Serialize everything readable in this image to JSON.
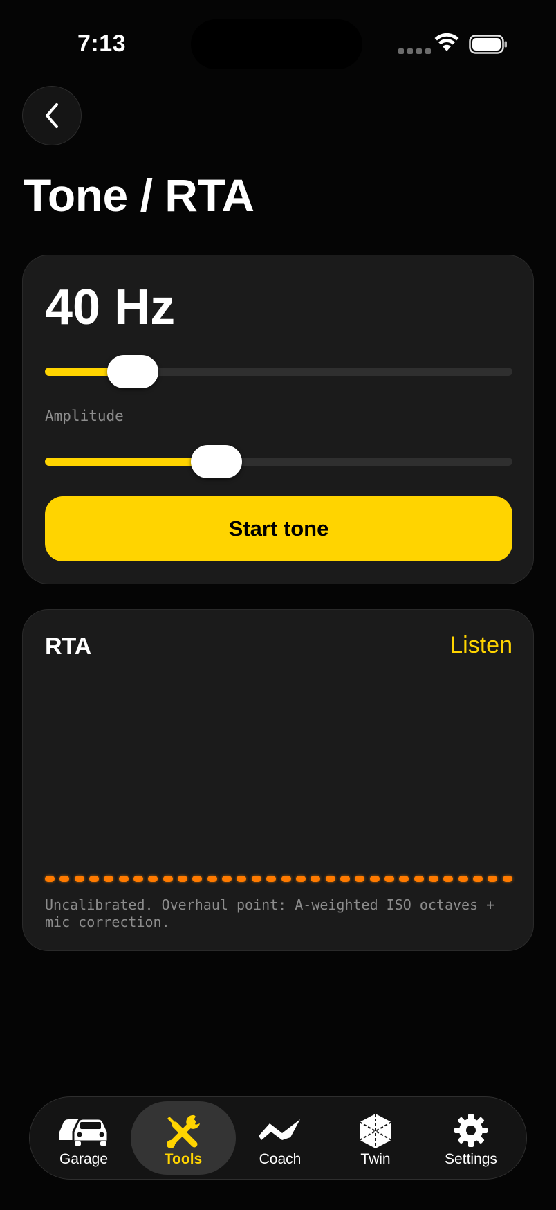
{
  "status_bar": {
    "time": "7:13"
  },
  "page": {
    "title": "Tone / RTA"
  },
  "tone": {
    "frequency_label": "40 Hz",
    "frequency_slider_fraction": 0.15,
    "amplitude_label": "Amplitude",
    "amplitude_slider_fraction": 0.35,
    "start_label": "Start tone"
  },
  "rta": {
    "title": "RTA",
    "listen_label": "Listen",
    "band_count": 32,
    "note": "Uncalibrated. Overhaul point: A-weighted ISO octaves + mic correction."
  },
  "tabs": [
    {
      "label": "Garage",
      "icon": "cars-icon",
      "active": false
    },
    {
      "label": "Tools",
      "icon": "wrench-screwdriver-icon",
      "active": true
    },
    {
      "label": "Coach",
      "icon": "waveform-icon",
      "active": false
    },
    {
      "label": "Twin",
      "icon": "cube-icon",
      "active": false
    },
    {
      "label": "Settings",
      "icon": "gear-icon",
      "active": false
    }
  ],
  "colors": {
    "accent": "#ffd400",
    "rta_bar": "#ff7a00",
    "background": "#050505",
    "card": "#1b1b1b"
  }
}
